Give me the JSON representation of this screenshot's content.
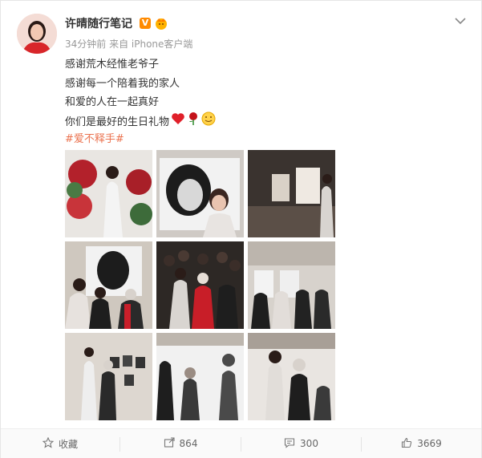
{
  "post": {
    "author": "许晴随行笔记",
    "verified_badge": "V",
    "meta": "34分钟前 来自 iPhone客户端",
    "lines": [
      "感谢荒木经惟老爷子",
      "感谢每一个陪着我的家人",
      "和爱的人在一起真好",
      "你们是最好的生日礼物"
    ],
    "emoji_icons": [
      "red-heart-icon",
      "rose-icon",
      "smile-icon"
    ],
    "topic": "#爱不释手#"
  },
  "actions": {
    "favorite_label": "收藏",
    "repost_count": "864",
    "comment_count": "300",
    "like_count": "3669"
  },
  "colors": {
    "topic": "#eb7350",
    "badge": "#ff8a00",
    "text": "#333333",
    "meta": "#999999"
  }
}
